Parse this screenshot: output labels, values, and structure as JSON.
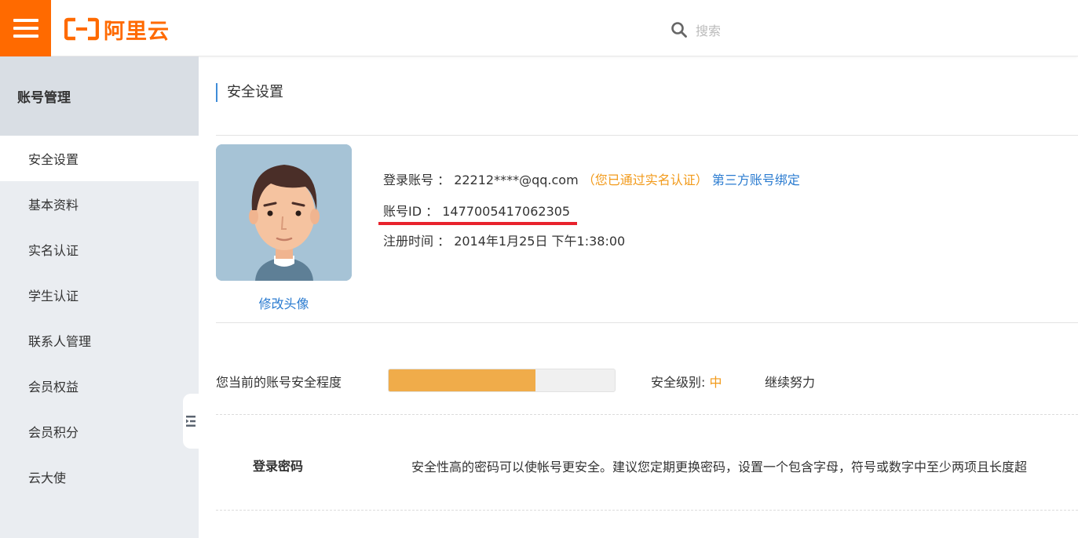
{
  "header": {
    "logo_text": "阿里云",
    "search_placeholder": "搜索",
    "brand_color": "#ff6a00"
  },
  "sidebar": {
    "title": "账号管理",
    "items": [
      {
        "label": "安全设置",
        "active": true
      },
      {
        "label": "基本资料"
      },
      {
        "label": "实名认证"
      },
      {
        "label": "学生认证"
      },
      {
        "label": "联系人管理"
      },
      {
        "label": "会员权益"
      },
      {
        "label": "会员积分"
      },
      {
        "label": "云大使"
      }
    ]
  },
  "main": {
    "title": "安全设置",
    "change_avatar": "修改头像",
    "login_account_label": "登录账号 ：",
    "login_account_value": "22212****@qq.com",
    "verified_open": "（",
    "verified_text": "您已通过实名认证",
    "verified_close": "）",
    "third_party_link": "第三方账号绑定",
    "account_id_label": "账号ID ：",
    "account_id_value": "1477005417062305",
    "register_time_label": "注册时间 ：",
    "register_time_value": "2014年1月25日 下午1:38:00",
    "security_label": "您当前的账号安全程度",
    "security_progress": 0.65,
    "security_level_label": "安全级别:",
    "security_level_value": "中",
    "keep_going": "继续努力",
    "password_label": "登录密码",
    "password_desc": "安全性高的密码可以使帐号更安全。建议您定期更换密码，设置一个包含字母，符号或数字中至少两项且长度超"
  }
}
